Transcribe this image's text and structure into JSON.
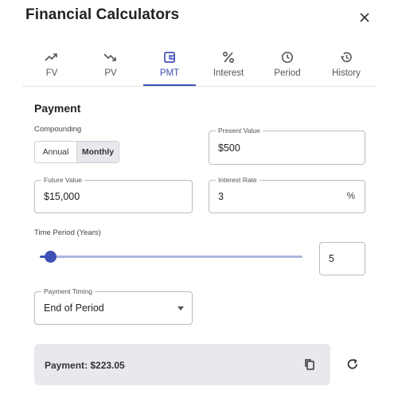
{
  "dialog": {
    "title": "Financial Calculators",
    "close_icon": "close-icon"
  },
  "tabs": [
    {
      "label": "FV",
      "icon": "trending-up-icon",
      "active": false
    },
    {
      "label": "PV",
      "icon": "trending-down-icon",
      "active": false
    },
    {
      "label": "PMT",
      "icon": "wallet-icon",
      "active": true
    },
    {
      "label": "Interest",
      "icon": "percent-icon",
      "active": false
    },
    {
      "label": "Period",
      "icon": "clock-icon",
      "active": false
    },
    {
      "label": "History",
      "icon": "history-icon",
      "active": false
    }
  ],
  "form": {
    "section_title": "Payment",
    "compounding": {
      "label": "Compounding",
      "options": [
        "Annual",
        "Monthly"
      ],
      "selected": "Monthly"
    },
    "present_value": {
      "label": "Present Value",
      "value": "$500"
    },
    "future_value": {
      "label": "Future Value",
      "value": "$15,000"
    },
    "interest_rate": {
      "label": "Interest Rate",
      "value": "3",
      "suffix": "%"
    },
    "time_period": {
      "label": "Time Period (Years)",
      "value": "5",
      "slider_fraction": 0.03
    },
    "payment_timing": {
      "label": "Payment Timing",
      "value": "End of Period"
    }
  },
  "result": {
    "text": "Payment: $223.05"
  },
  "colors": {
    "accent": "#3f51b5",
    "result_bg": "#e8e9ee",
    "track": "#aeb6dc"
  }
}
